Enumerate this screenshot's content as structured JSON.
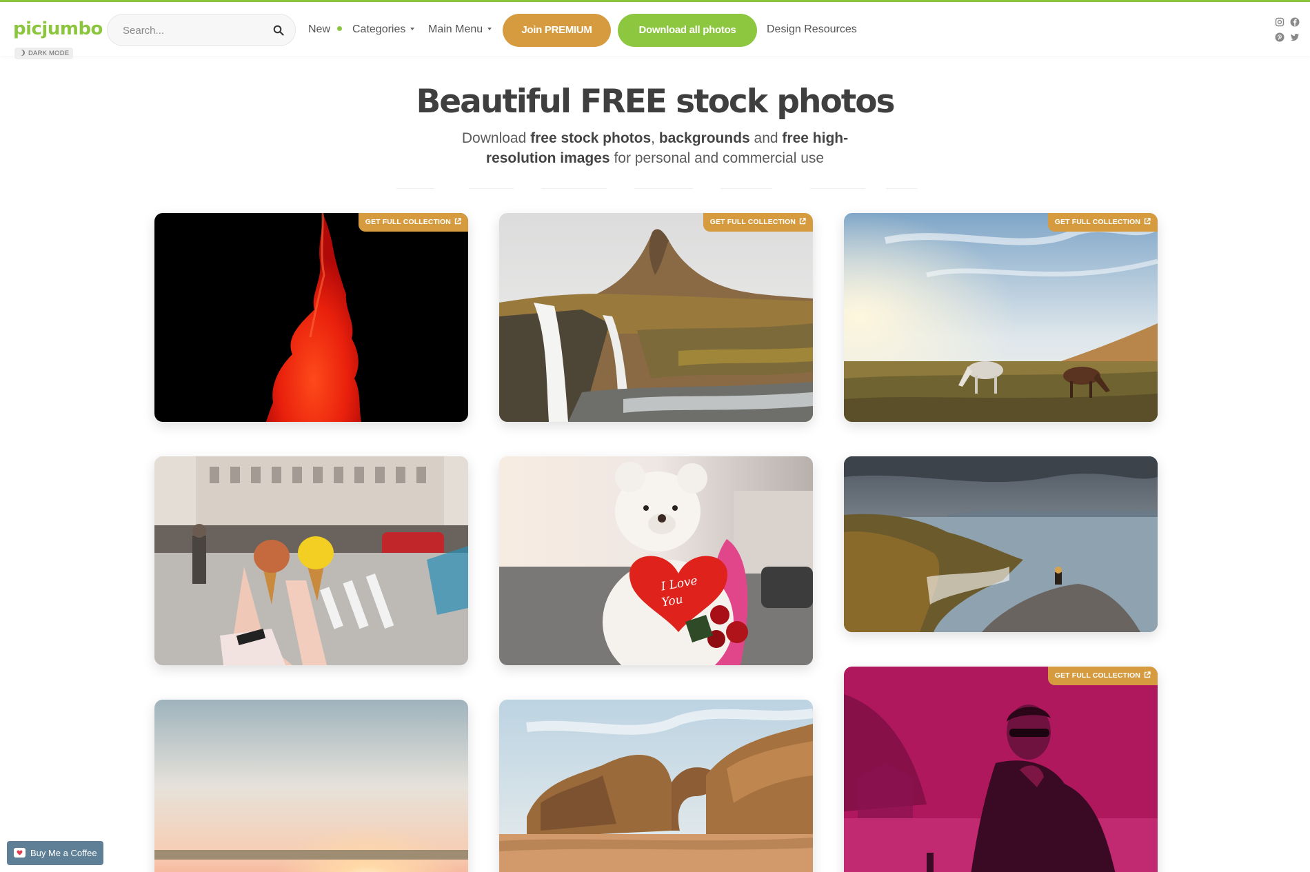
{
  "header": {
    "logo": "picjumbo",
    "dark_mode_label": "DARK MODE",
    "search_placeholder": "Search...",
    "nav": {
      "new_label": "New",
      "categories_label": "Categories",
      "main_menu_label": "Main Menu",
      "design_resources_label": "Design Resources"
    },
    "join_premium_label": "Join PREMIUM",
    "download_all_label": "Download all photos",
    "social_icons": [
      "instagram-icon",
      "facebook-icon",
      "pinterest-icon",
      "twitter-icon"
    ]
  },
  "hero": {
    "title": "Beautiful FREE stock photos",
    "subtitle_parts": {
      "p1": "Download ",
      "b1": "free stock photos",
      "p2": ", ",
      "b2": "backgrounds",
      "p3": " and ",
      "b3": "free high-resolution images",
      "p4": " for personal and commercial use"
    }
  },
  "gallery": {
    "badge_label": "GET FULL COLLECTION",
    "photos": [
      {
        "subject": "red ink in water on black background",
        "has_badge": true
      },
      {
        "subject": "Kirkjufell mountain and waterfall",
        "has_badge": true
      },
      {
        "subject": "horses grazing on a meadow",
        "has_badge": true
      },
      {
        "subject": "two ice cream cones held up in a city street",
        "has_badge": false
      },
      {
        "subject": "teddy bear holding a heart",
        "has_badge": false,
        "heart_text_line1": "I Love",
        "heart_text_line2": "You"
      },
      {
        "subject": "person on a sea cliff",
        "has_badge": false
      },
      {
        "subject": "sunset over a field",
        "has_badge": false
      },
      {
        "subject": "sandstone rock arch on a beach",
        "has_badge": false
      },
      {
        "subject": "man in sunglasses magenta tint",
        "has_badge": true
      }
    ]
  },
  "buy_me_coffee_label": "Buy Me a Coffee",
  "colors": {
    "brand_green": "#8cc63f",
    "premium_orange": "#d59b3e",
    "title_gray": "#3f3f3f"
  }
}
